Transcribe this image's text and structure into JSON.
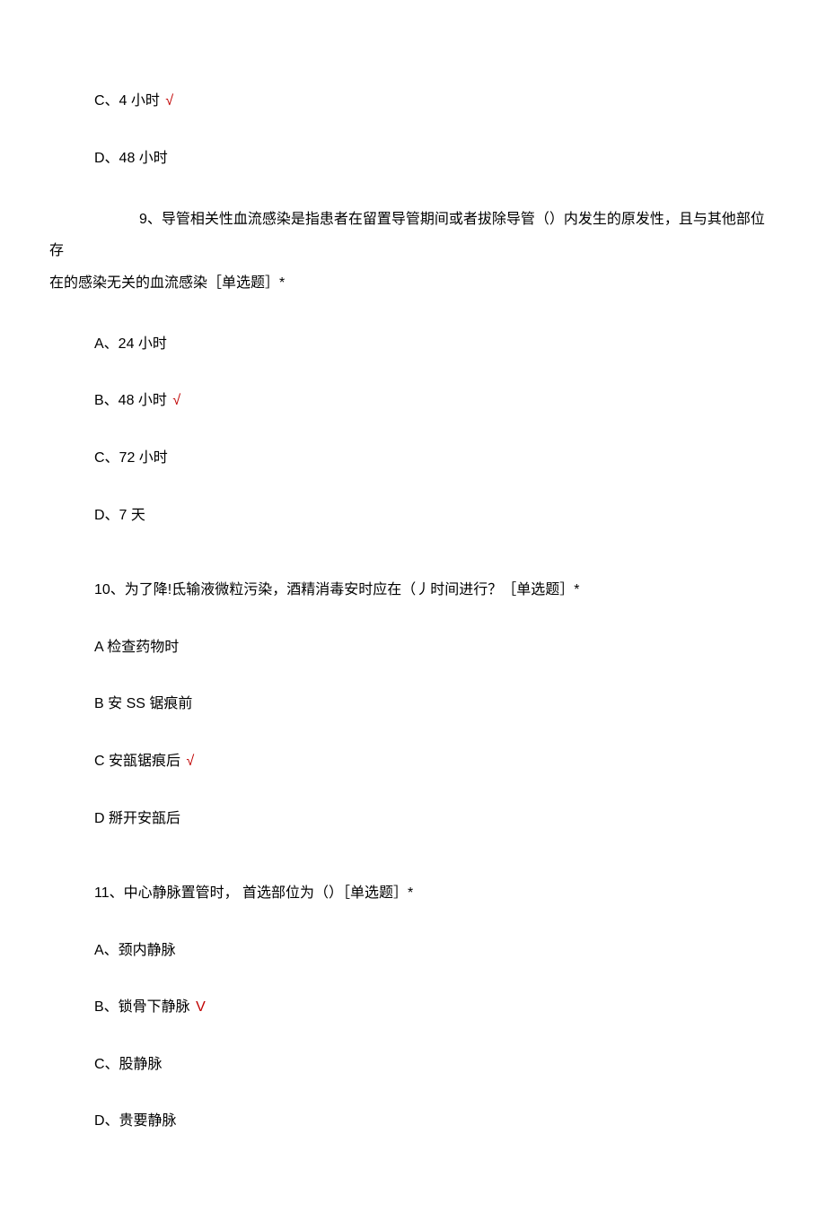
{
  "partial_options_top": [
    {
      "label": "C、4 小时",
      "correct": true
    },
    {
      "label": "D、48 小时",
      "correct": false
    }
  ],
  "questions": [
    {
      "number": "9",
      "text_first_line": "9、导管相关性血流感染是指患者在留置导管期间或者拔除导管（）内发生的原发性，且与其他部位存",
      "text_second_line": "在的感染无关的血流感染［单选题］*",
      "options": [
        {
          "label": "A、24 小时",
          "correct": false
        },
        {
          "label": "B、48 小时",
          "correct": true
        },
        {
          "label": "C、72 小时",
          "correct": false
        },
        {
          "label": "D、7 天",
          "correct": false
        }
      ]
    },
    {
      "number": "10",
      "text_first_line": "10、为了降!氐输液微粒污染，酒精消毒安时应在（丿时间进行？［单选题］*",
      "text_second_line": "",
      "options": [
        {
          "label": "A 检查药物时",
          "correct": false
        },
        {
          "label": "B 安 SS 锯痕前",
          "correct": false
        },
        {
          "label": "C 安瓿锯痕后",
          "correct": true
        },
        {
          "label": "D 掰开安瓿后",
          "correct": false
        }
      ]
    },
    {
      "number": "11",
      "text_first_line": "11、中心静脉置管时， 首选部位为（）［单选题］*",
      "text_second_line": "",
      "options": [
        {
          "label": "A、颈内静脉",
          "correct": false
        },
        {
          "label": "B、锁骨下静脉",
          "correct": true,
          "mark": "V"
        },
        {
          "label": "C、股静脉",
          "correct": false
        },
        {
          "label": "D、贵要静脉",
          "correct": false
        }
      ]
    }
  ],
  "check_mark": "√"
}
